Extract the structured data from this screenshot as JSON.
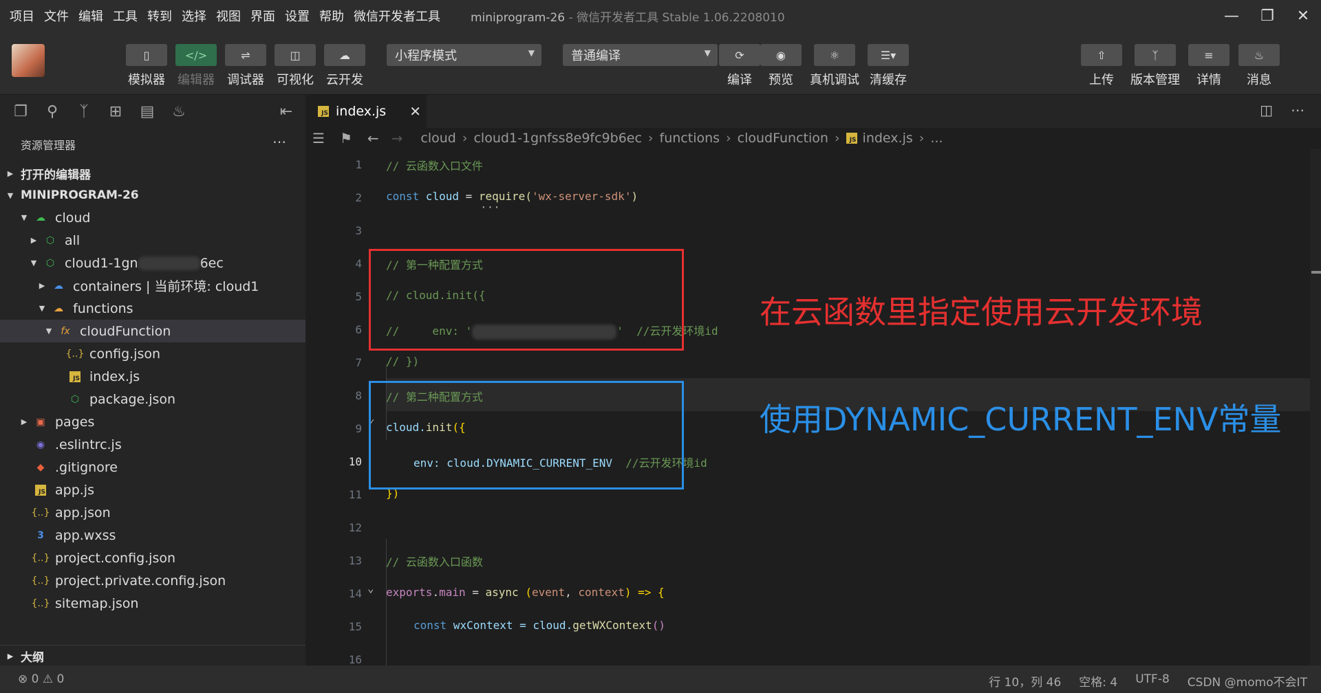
{
  "menu": [
    "项目",
    "文件",
    "编辑",
    "工具",
    "转到",
    "选择",
    "视图",
    "界面",
    "设置",
    "帮助",
    "微信开发者工具"
  ],
  "window": {
    "title": "miniprogram-26",
    "subtitle": " - 微信开发者工具 Stable 1.06.2208010"
  },
  "toolbar": {
    "simulator": "模拟器",
    "editor": "编辑器",
    "debugger": "调试器",
    "visual": "可视化",
    "cloud": "云开发",
    "mode": "小程序模式",
    "compile_mode": "普通编译",
    "compile": "编译",
    "preview": "预览",
    "remote_debug": "真机调试",
    "clear_cache": "清缓存",
    "upload": "上传",
    "version": "版本管理",
    "details": "详情",
    "messages": "消息"
  },
  "sidebar": {
    "header": "资源管理器",
    "open_editors": "打开的编辑器",
    "project": "MINIPROGRAM-26",
    "tree": {
      "cloud": "cloud",
      "all": "all",
      "cloud1_prefix": "cloud1-1gn",
      "cloud1_suffix": "6ec",
      "containers": "containers | 当前环境: cloud1",
      "functions": "functions",
      "cloudFunction": "cloudFunction",
      "config": "config.json",
      "index": "index.js",
      "package": "package.json",
      "pages": "pages",
      "eslintrc": ".eslintrc.js",
      "gitignore": ".gitignore",
      "appjs": "app.js",
      "appjson": "app.json",
      "appwxss": "app.wxss",
      "projectconfig": "project.config.json",
      "projectprivate": "project.private.config.json",
      "sitemap": "sitemap.json"
    },
    "outline": "大纲"
  },
  "tab": {
    "name": "index.js"
  },
  "breadcrumb": [
    "cloud",
    "cloud1-1gnfss8e9fc9b6ec",
    "functions",
    "cloudFunction",
    "index.js",
    "..."
  ],
  "code": {
    "l1": "// 云函数入口文件",
    "l2a": "const",
    "l2b": " cloud ",
    "l2c": "=",
    "l2d": " require(",
    "l2e": "'wx-server-sdk'",
    "l2f": ")",
    "l4": "// 第一种配置方式",
    "l5": "// cloud.init({",
    "l6a": "//     env: '",
    "l6b": "'  //云开发环境id",
    "l7": "// })",
    "l8": "// 第二种配置方式",
    "l9a": "cloud.",
    "l9b": "init",
    "l9c": "({",
    "l10a": "env: cloud.DYNAMIC_CURRENT_ENV  ",
    "l10b": "//云开发环境id",
    "l11": "})",
    "l13": "// 云函数入口函数",
    "l14a": "exports",
    "l14b": ".",
    "l14c": "main",
    "l14d": " = ",
    "l14e": "async",
    "l14f": " (",
    "l14g": "event",
    "l14h": ", ",
    "l14i": "context",
    "l14j": ") => {",
    "l15a": "const",
    "l15b": " wxContext = cloud.",
    "l15c": "getWXContext",
    "l15d": "()"
  },
  "annotations": {
    "red": "在云函数里指定使用云开发环境",
    "blue": "使用DYNAMIC_CURRENT_ENV常量",
    "red_color": "#e53030",
    "blue_color": "#2b8fe6"
  },
  "status": {
    "errors": "⊗ 0 ⚠ 0",
    "position": "行 10，列 46",
    "spaces": "空格: 4",
    "encoding": "UTF-8",
    "watermark": "CSDN @momo不会IT"
  }
}
